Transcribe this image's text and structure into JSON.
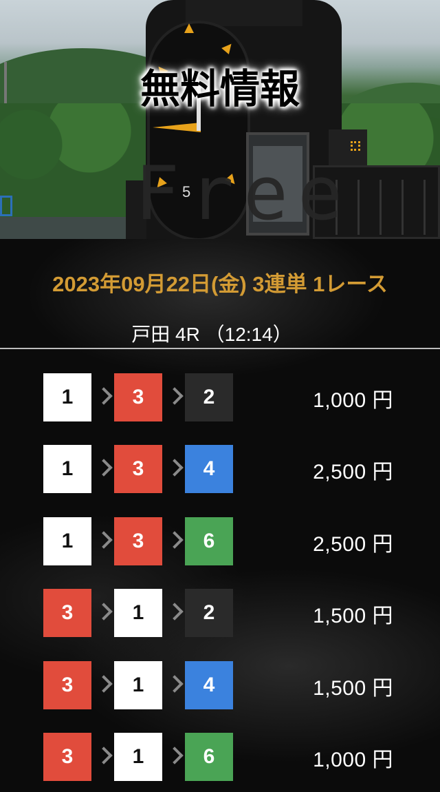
{
  "header": {
    "title": "無料情報",
    "free_text": "Free",
    "clock_digit": "5"
  },
  "info": {
    "date_line": "2023年09月22日(金) 3連単 1レース",
    "race_line": "戸田 4R （12:14）"
  },
  "colors": {
    "gold": "#d39b34",
    "boat_1": "#ffffff",
    "boat_2": "#2a2a2a",
    "boat_3": "#e14c3c",
    "boat_4": "#3b82de",
    "boat_6": "#4aa455"
  },
  "bets": [
    {
      "first": "1",
      "second": "3",
      "third": "2",
      "amount": "1,000 円"
    },
    {
      "first": "1",
      "second": "3",
      "third": "4",
      "amount": "2,500 円"
    },
    {
      "first": "1",
      "second": "3",
      "third": "6",
      "amount": "2,500 円"
    },
    {
      "first": "3",
      "second": "1",
      "third": "2",
      "amount": "1,500 円"
    },
    {
      "first": "3",
      "second": "1",
      "third": "4",
      "amount": "1,500 円"
    },
    {
      "first": "3",
      "second": "1",
      "third": "6",
      "amount": "1,000 円"
    }
  ]
}
